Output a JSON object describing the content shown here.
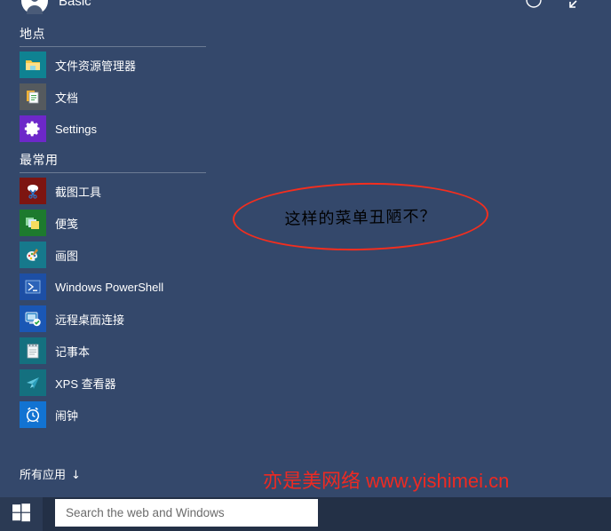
{
  "colors": {
    "menu_background": "#34486b",
    "taskbar_background": "#233046",
    "start_button_background": "#2b3a54",
    "annotation_red": "#f42e1e",
    "watermark_red": "#ee2a22",
    "search_box_background": "#ffffff"
  },
  "account": {
    "name": "Basic",
    "avatar_icon": "user-avatar-icon"
  },
  "top_controls": [
    {
      "name": "power-icon",
      "label": ""
    },
    {
      "name": "expand-icon",
      "label": ""
    }
  ],
  "sections": [
    {
      "key": "places",
      "header": "地点",
      "items": [
        {
          "label": "文件资源管理器",
          "icon": "file-explorer-icon",
          "tile_color": "#0f8292",
          "latin": false
        },
        {
          "label": "文档",
          "icon": "documents-icon",
          "tile_color": "#555a5e",
          "latin": false
        },
        {
          "label": "Settings",
          "icon": "settings-gear-icon",
          "tile_color": "#6d28c9",
          "latin": true
        }
      ]
    },
    {
      "key": "most_used",
      "header": "最常用",
      "items": [
        {
          "label": "截图工具",
          "icon": "snipping-tool-icon",
          "tile_color": "#7d1511",
          "latin": false
        },
        {
          "label": "便笺",
          "icon": "sticky-notes-icon",
          "tile_color": "#1d7a2e",
          "latin": false
        },
        {
          "label": "画图",
          "icon": "paint-icon",
          "tile_color": "#16798c",
          "latin": false
        },
        {
          "label": "Windows PowerShell",
          "icon": "powershell-icon",
          "tile_color": "#1d4fa5",
          "latin": true
        },
        {
          "label": "远程桌面连接",
          "icon": "remote-desktop-icon",
          "tile_color": "#1a57b5",
          "latin": false
        },
        {
          "label": "记事本",
          "icon": "notepad-icon",
          "tile_color": "#14707f",
          "latin": false
        },
        {
          "label": "XPS 查看器",
          "icon": "xps-viewer-icon",
          "tile_color": "#14707f",
          "latin": true
        },
        {
          "label": "闹钟",
          "icon": "alarm-clock-icon",
          "tile_color": "#1273d2",
          "latin": false
        }
      ]
    }
  ],
  "all_apps": {
    "label": "所有应用",
    "arrow": "↓"
  },
  "annotation": {
    "text": "这样的菜单丑陋不？"
  },
  "watermark": {
    "brand": "亦是美网络",
    "url": "www.yishimei.cn"
  },
  "taskbar": {
    "start_button_icon": "windows-logo-icon",
    "search": {
      "value": "",
      "placeholder": "Search the web and Windows"
    }
  }
}
